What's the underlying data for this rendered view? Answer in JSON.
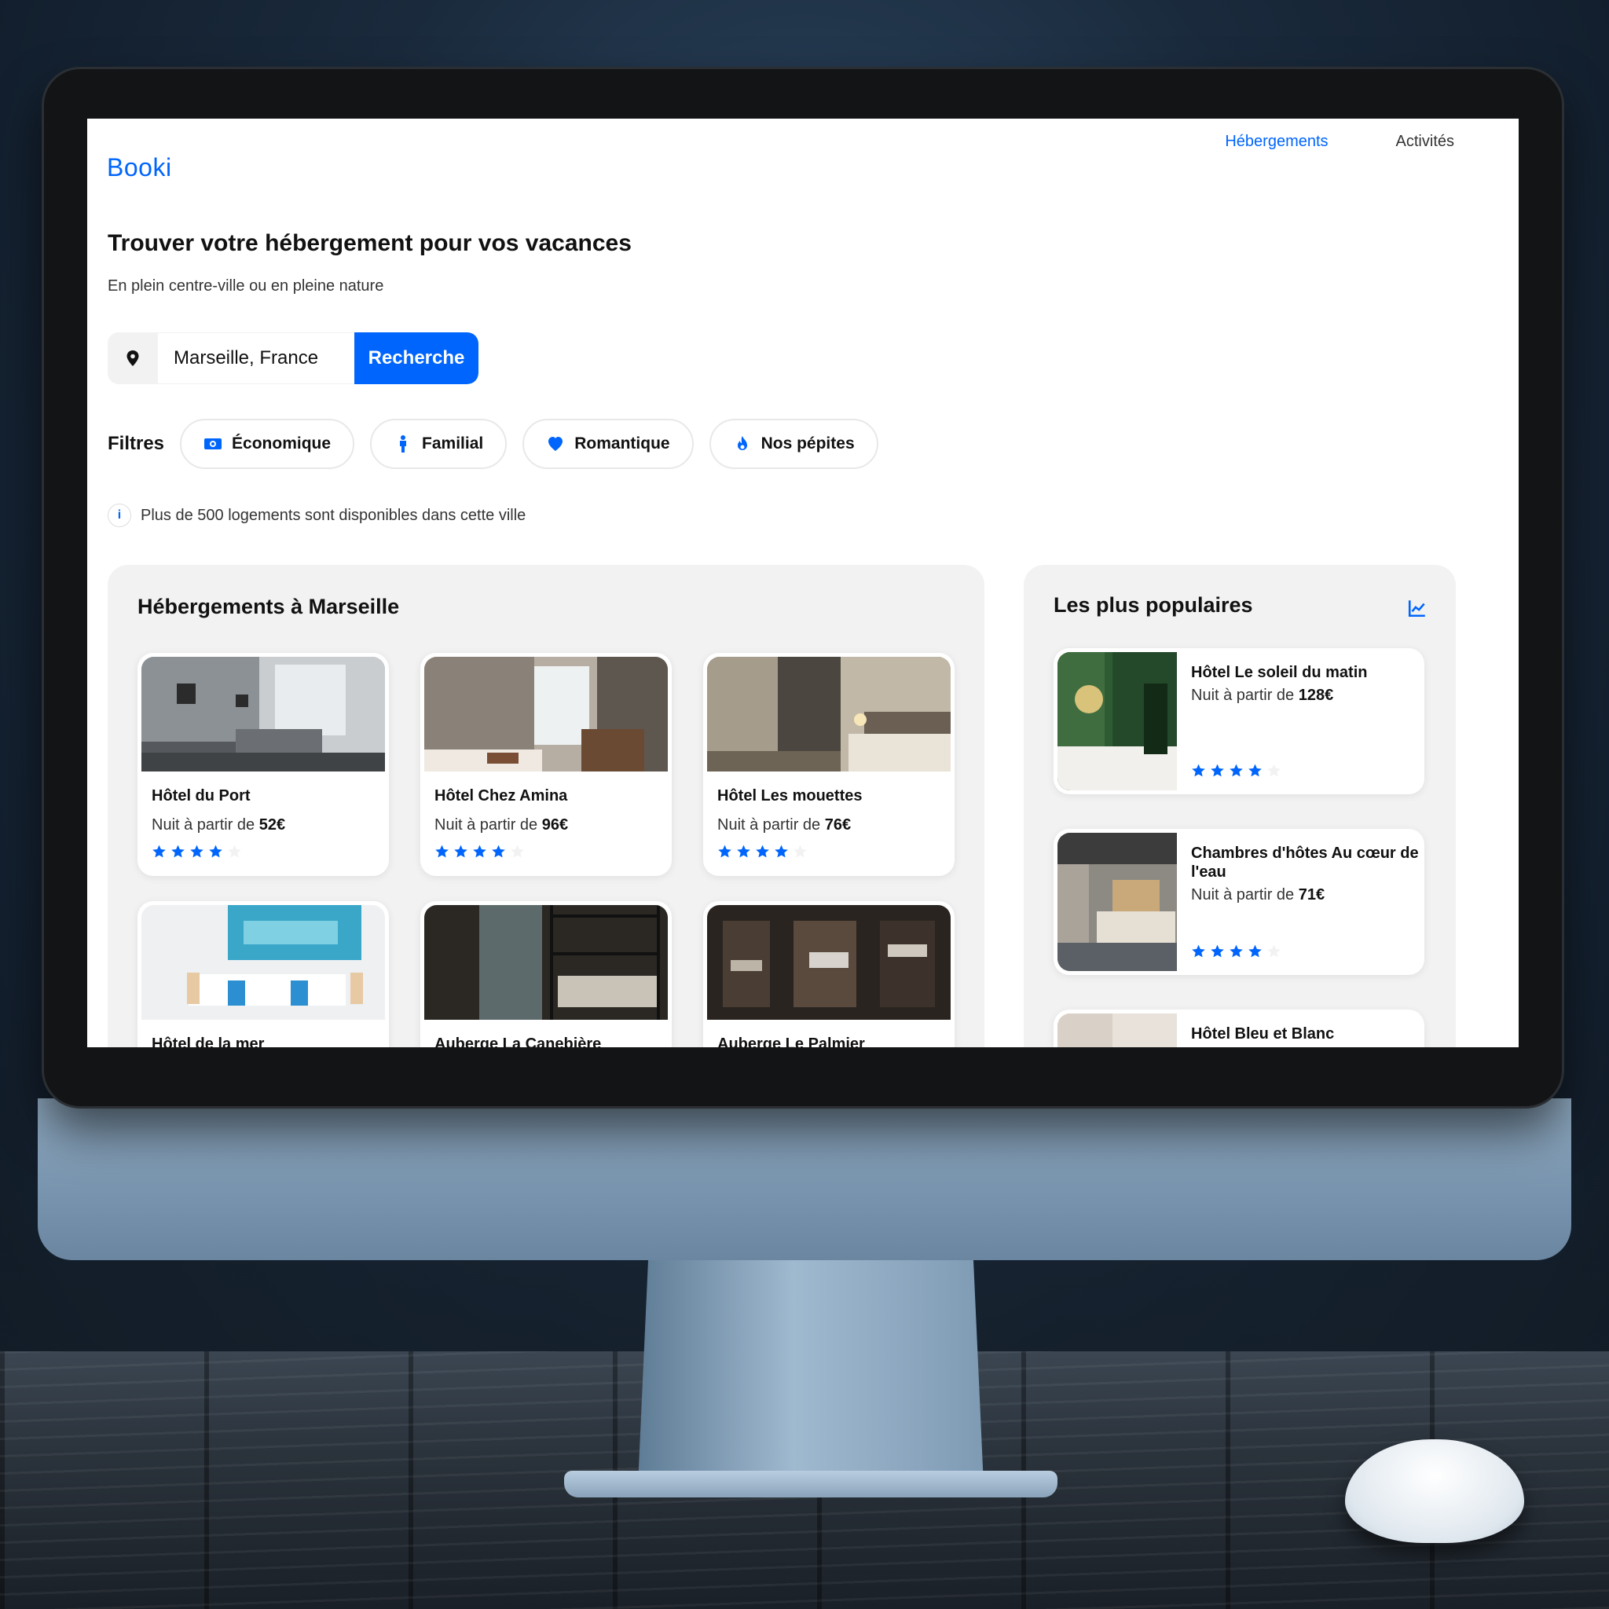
{
  "brand": {
    "logo": "Booki",
    "accent": "#0065fc"
  },
  "nav": {
    "items": [
      {
        "label": "Hébergements",
        "active": true
      },
      {
        "label": "Activités",
        "active": false
      }
    ]
  },
  "hero": {
    "title": "Trouver votre hébergement pour vos vacances",
    "subtitle": "En plein centre-ville ou en pleine nature"
  },
  "search": {
    "location": "Marseille, France",
    "button": "Recherche",
    "icon": "location-pin-icon"
  },
  "filters": {
    "label": "Filtres",
    "items": [
      {
        "label": "Économique",
        "icon": "money-icon"
      },
      {
        "label": "Familial",
        "icon": "person-icon"
      },
      {
        "label": "Romantique",
        "icon": "heart-icon"
      },
      {
        "label": "Nos pépites",
        "icon": "fire-icon"
      }
    ]
  },
  "info": {
    "text": "Plus de 500 logements sont disponibles dans cette ville",
    "icon": "info-icon"
  },
  "listings": {
    "title": "Hébergements à Marseille",
    "items": [
      {
        "name": "Hôtel du Port",
        "price_prefix": "Nuit à partir de",
        "price": "52€",
        "rating": 4
      },
      {
        "name": "Hôtel Chez Amina",
        "price_prefix": "Nuit à partir de",
        "price": "96€",
        "rating": 4
      },
      {
        "name": "Hôtel Les mouettes",
        "price_prefix": "Nuit à partir de",
        "price": "76€",
        "rating": 4
      },
      {
        "name": "Hôtel de la mer",
        "price_prefix": "",
        "price": "",
        "rating": 0
      },
      {
        "name": "Auberge La Canebière",
        "price_prefix": "",
        "price": "",
        "rating": 0
      },
      {
        "name": "Auberge Le Palmier",
        "price_prefix": "",
        "price": "",
        "rating": 0
      }
    ]
  },
  "popular": {
    "title": "Les plus populaires",
    "icon": "trend-chart-icon",
    "items": [
      {
        "name": "Hôtel Le soleil du matin",
        "price_prefix": "Nuit à partir de",
        "price": "128€",
        "rating": 4
      },
      {
        "name": "Chambres d'hôtes Au cœur de l'eau",
        "price_prefix": "Nuit à partir de",
        "price": "71€",
        "rating": 4
      },
      {
        "name": "Hôtel Bleu et Blanc",
        "price_prefix": "",
        "price": "",
        "rating": 0
      }
    ]
  }
}
